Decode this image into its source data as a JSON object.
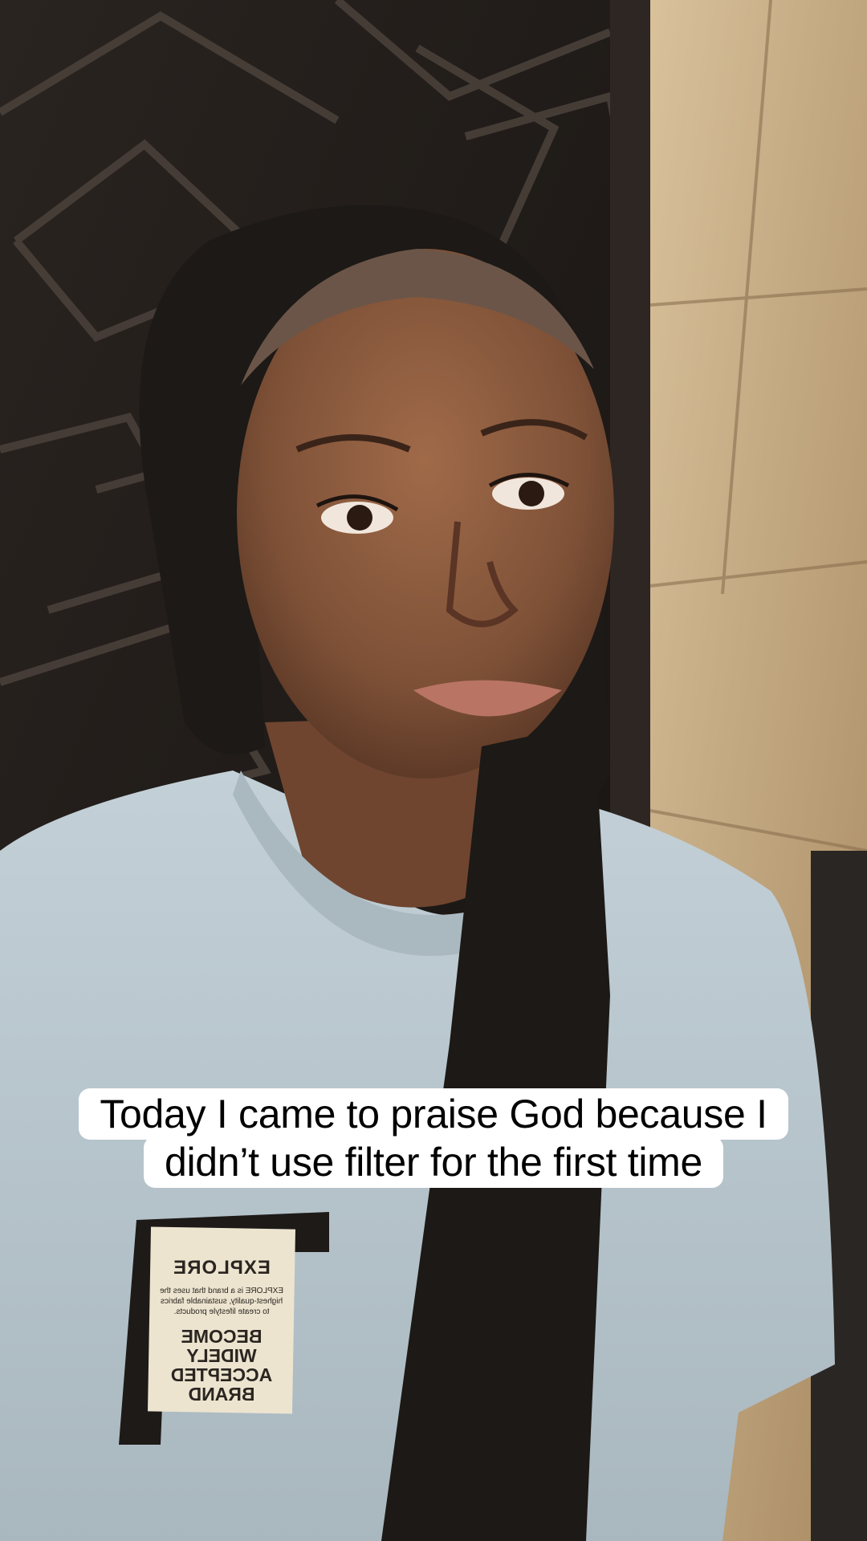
{
  "caption": {
    "line1": "Today I came to praise God because I",
    "line2": "didn’t use filter for the first time"
  },
  "shirt_patch": {
    "brand": "EXPLORE",
    "body": "EXPLORE is a brand that uses the highest-quality, sustainable fabrics to create lifestyle products.",
    "slogan": "BECOME WIDELY ACCEPTED BRAND"
  },
  "colors": {
    "door": "#201b17",
    "wall_tile": "#c9ae86",
    "shirt": "#b9c6cd",
    "scarf": "#1c1916",
    "skin": "#8a5a3e",
    "caption_bg": "#ffffff",
    "caption_text": "#000000"
  }
}
